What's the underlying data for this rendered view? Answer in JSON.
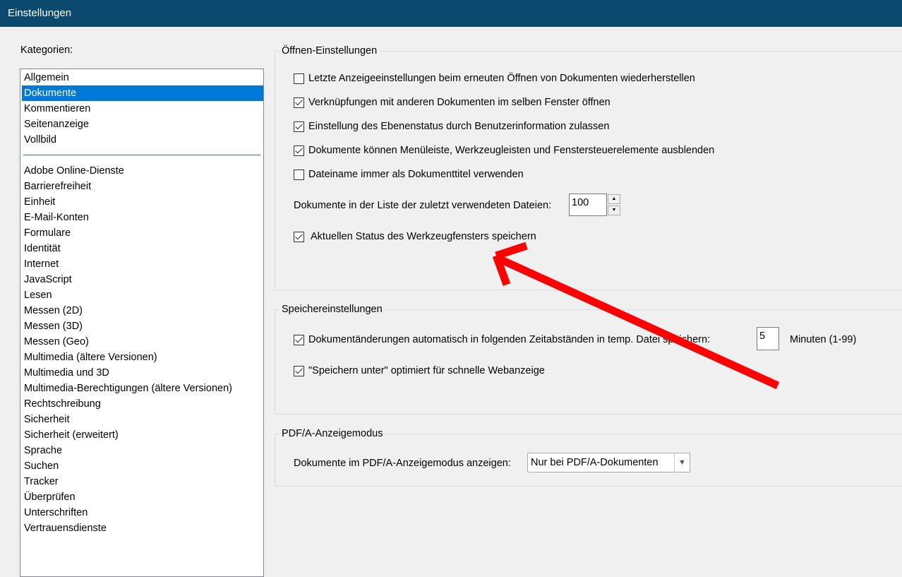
{
  "window": {
    "title": "Einstellungen"
  },
  "categories": {
    "label": "Kategorien:",
    "selected_index": 1,
    "group1": [
      "Allgemein",
      "Dokumente",
      "Kommentieren",
      "Seitenanzeige",
      "Vollbild"
    ],
    "group2": [
      "Adobe Online-Dienste",
      "Barrierefreiheit",
      "Einheit",
      "E-Mail-Konten",
      "Formulare",
      "Identität",
      "Internet",
      "JavaScript",
      "Lesen",
      "Messen (2D)",
      "Messen (3D)",
      "Messen (Geo)",
      "Multimedia (ältere Versionen)",
      "Multimedia und 3D",
      "Multimedia-Berechtigungen (ältere Versionen)",
      "Rechtschreibung",
      "Sicherheit",
      "Sicherheit (erweitert)",
      "Sprache",
      "Suchen",
      "Tracker",
      "Überprüfen",
      "Unterschriften",
      "Vertrauensdienste"
    ]
  },
  "open_settings": {
    "title": "Öffnen-Einstellungen",
    "options": [
      {
        "label": "Letzte Anzeigeeinstellungen beim erneuten Öffnen von Dokumenten wiederherstellen",
        "checked": false
      },
      {
        "label": "Verknüpfungen mit anderen Dokumenten im selben Fenster öffnen",
        "checked": true
      },
      {
        "label": "Einstellung des Ebenenstatus durch Benutzerinformation zulassen",
        "checked": true
      },
      {
        "label": "Dokumente können Menüleiste, Werkzeugleisten und Fenstersteuerelemente ausblenden",
        "checked": true
      },
      {
        "label": "Dateiname immer als Dokumenttitel verwenden",
        "checked": false
      }
    ],
    "recent_docs_label": "Dokumente in der Liste der zuletzt verwendeten Dateien:",
    "recent_docs_value": "100",
    "tool_state": {
      "label": "Aktuellen Status des Werkzeugfensters speichern",
      "checked": true
    }
  },
  "save_settings": {
    "title": "Speichereinstellungen",
    "autosave": {
      "label": "Dokumentänderungen automatisch in folgenden Zeitabständen in temp. Datei speichern:",
      "checked": true,
      "value": "5",
      "unit": "Minuten (1-99)"
    },
    "fast_web": {
      "label": "\"Speichern unter\" optimiert für schnelle Webanzeige",
      "checked": true
    }
  },
  "pdfa": {
    "title": "PDF/A-Anzeigemodus",
    "label": "Dokumente im PDF/A-Anzeigemodus anzeigen:",
    "selected": "Nur bei PDF/A-Dokumenten"
  },
  "annotation": {
    "arrow_color": "#ff0000"
  },
  "colors": {
    "titlebar": "#0b4a6e",
    "selection": "#0078d7"
  }
}
